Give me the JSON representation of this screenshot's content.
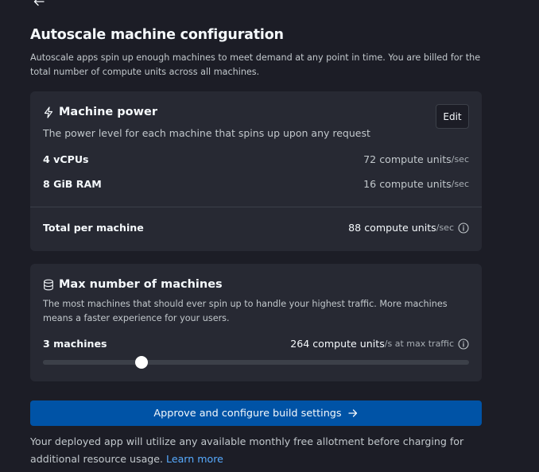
{
  "header": {
    "back_icon": "arrow-left-icon",
    "title": "Autoscale machine configuration",
    "subtitle": "Autoscale apps spin up enough machines to meet demand at any point in time. You are billed for the total number of compute units across all machines."
  },
  "machine_power": {
    "icon": "lightning-icon",
    "title": "Machine power",
    "edit_label": "Edit",
    "description": "The power level for each machine that spins up upon any request",
    "rows": [
      {
        "label": "4 vCPUs",
        "value": "72 compute units",
        "unit": "/sec"
      },
      {
        "label": "8 GiB RAM",
        "value": "16 compute units",
        "unit": "/sec"
      }
    ],
    "total": {
      "label": "Total per machine",
      "value": "88 compute units",
      "unit": "/sec",
      "icon": "info-icon"
    }
  },
  "max_machines": {
    "icon": "database-icon",
    "title": "Max number of machines",
    "description": "The most machines that should ever spin up to handle your highest traffic. More machines means a faster experience for your users.",
    "count_label": "3 machines",
    "value": "264 compute units",
    "unit": "/s at max traffic",
    "slider_fraction": 0.231
  },
  "approve_label": "Approve and configure build settings",
  "footer": {
    "text": "Your deployed app will utilize any available monthly free allotment before charging for additional resource usage. ",
    "link": "Learn more"
  },
  "colors": {
    "background": "#1c1d26",
    "card": "#272933",
    "primary_button": "#0053a6",
    "link": "#57abff"
  }
}
